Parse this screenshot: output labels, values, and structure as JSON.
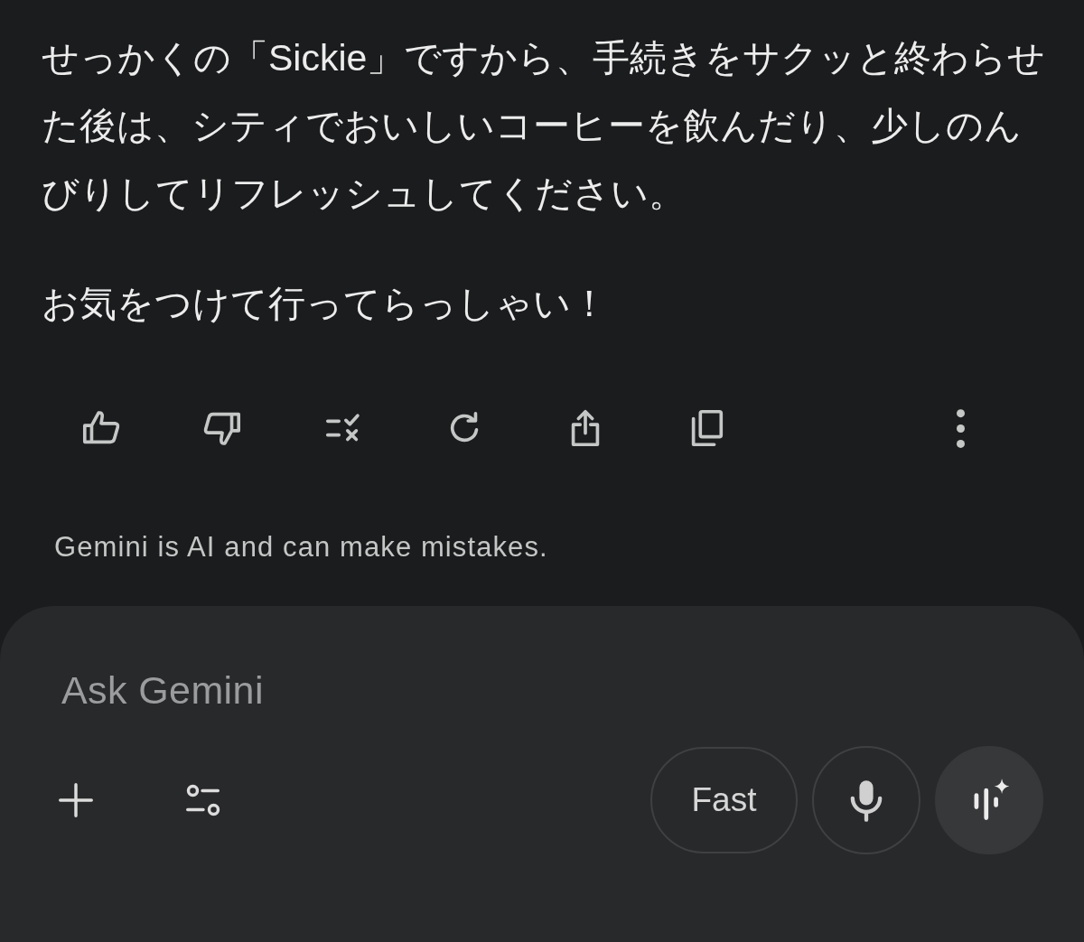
{
  "message": {
    "paragraphs": [
      "せっかくの「Sickie」ですから、手続きをサクッと終わらせた後は、シティでおいしいコーヒーを飲んだり、少しのんびりしてリフレッシュしてください。",
      "お気をつけて行ってらっしゃい！"
    ]
  },
  "disclaimer": "Gemini is AI and can make mistakes.",
  "composer": {
    "placeholder": "Ask Gemini",
    "mode_button": "Fast"
  }
}
